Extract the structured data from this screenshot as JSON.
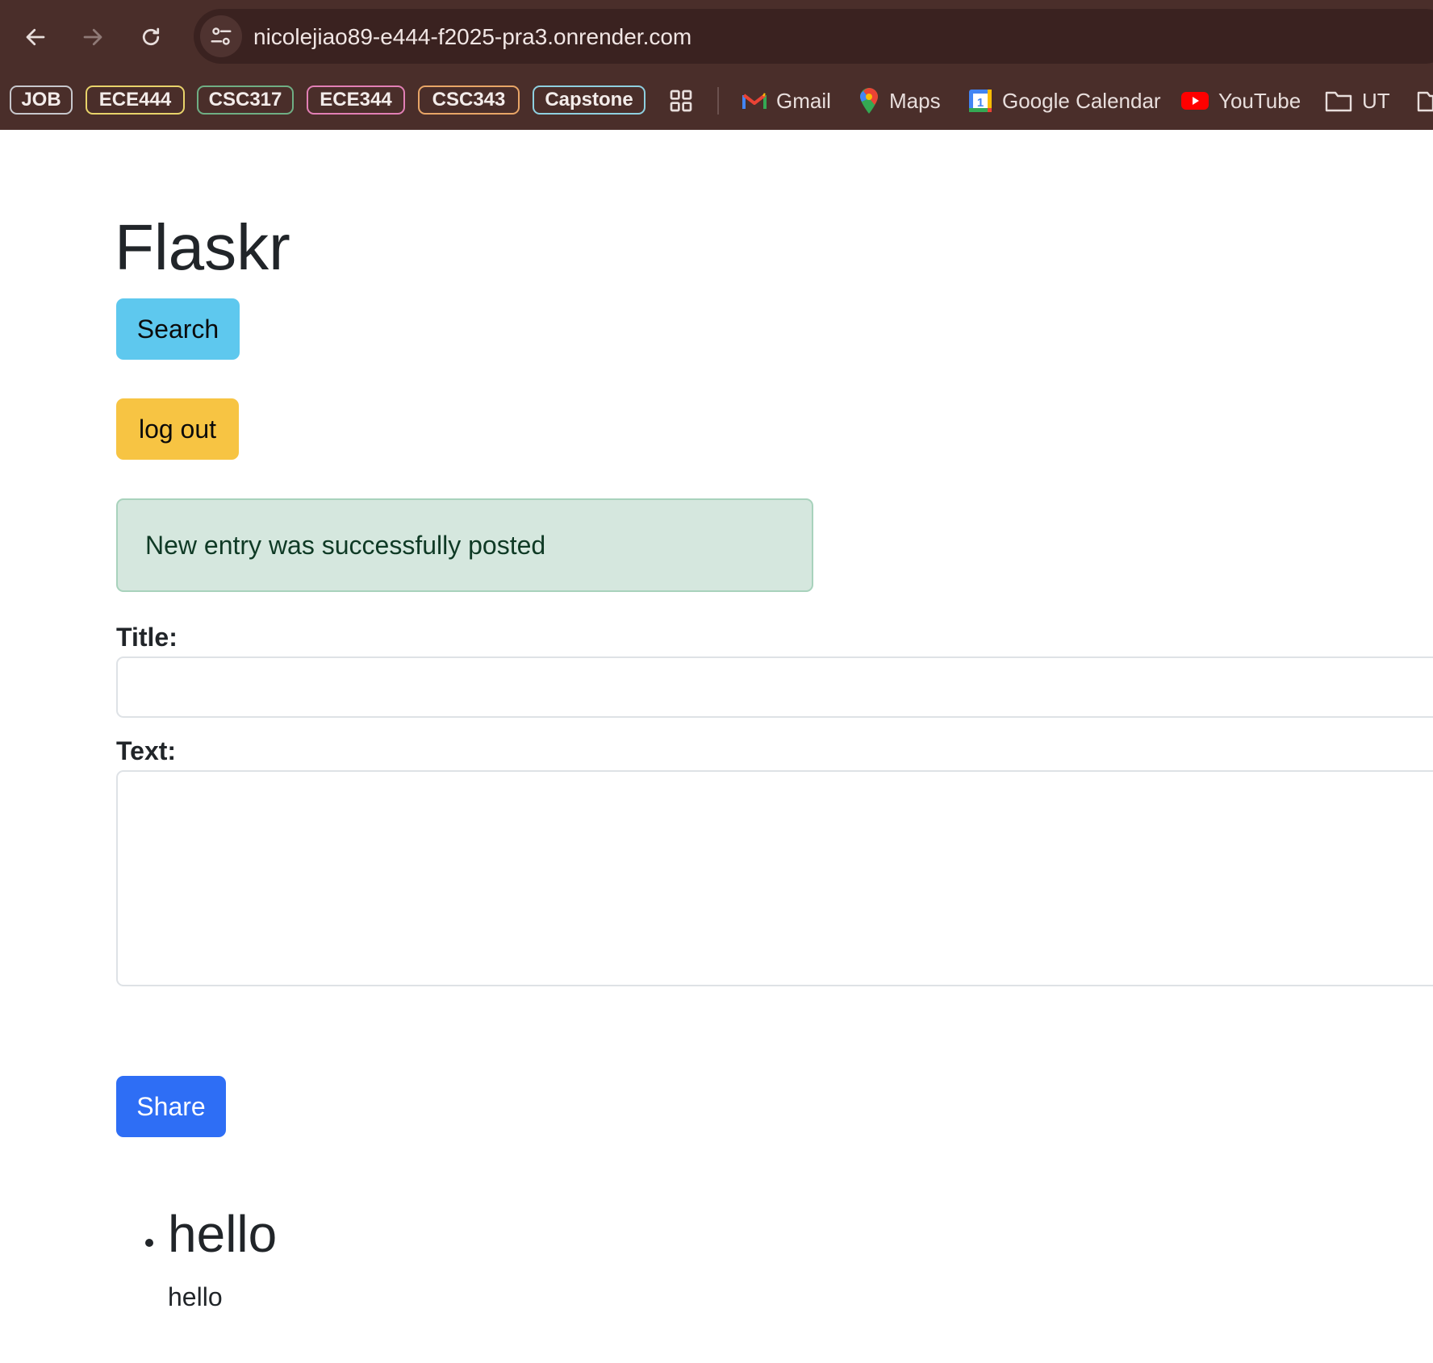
{
  "browser": {
    "url": "nicolejiao89-e444-f2025-pra3.onrender.com",
    "bookmark_groups": [
      {
        "label": "JOB",
        "color": "#c7c7cc"
      },
      {
        "label": "ECE444",
        "color": "#e8d36a"
      },
      {
        "label": "CSC317",
        "color": "#6fae84"
      },
      {
        "label": "ECE344",
        "color": "#e27fb5"
      },
      {
        "label": "CSC343",
        "color": "#e8a567"
      },
      {
        "label": "Capstone",
        "color": "#8ed0e0"
      }
    ],
    "bookmarks": {
      "gmail": "Gmail",
      "maps": "Maps",
      "calendar": "Google Calendar",
      "youtube": "YouTube",
      "ut": "UT"
    }
  },
  "page": {
    "title": "Flaskr",
    "search_button": "Search",
    "logout_button": "log out",
    "flash_message": "New entry was successfully posted",
    "form": {
      "title_label": "Title:",
      "title_value": "",
      "text_label": "Text:",
      "text_value": "",
      "share_button": "Share"
    },
    "entries": [
      {
        "title": "hello",
        "text": "hello"
      }
    ]
  }
}
